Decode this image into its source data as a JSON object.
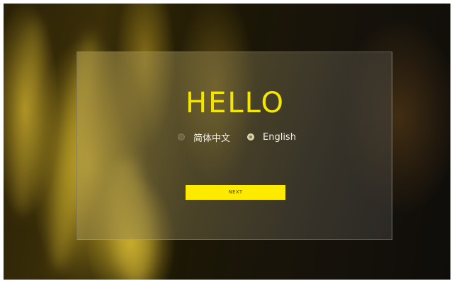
{
  "welcome": {
    "title": "HELLO",
    "languages": [
      {
        "label": "简体中文",
        "selected": false
      },
      {
        "label": "English",
        "selected": true
      }
    ],
    "next_label": "NEXT"
  },
  "colors": {
    "accent": "#fcea00",
    "title": "#f5e600",
    "label": "#f3f1ea"
  },
  "icons": {
    "radio_unselected": "radio-unselected-icon",
    "radio_selected": "radio-selected-icon"
  }
}
